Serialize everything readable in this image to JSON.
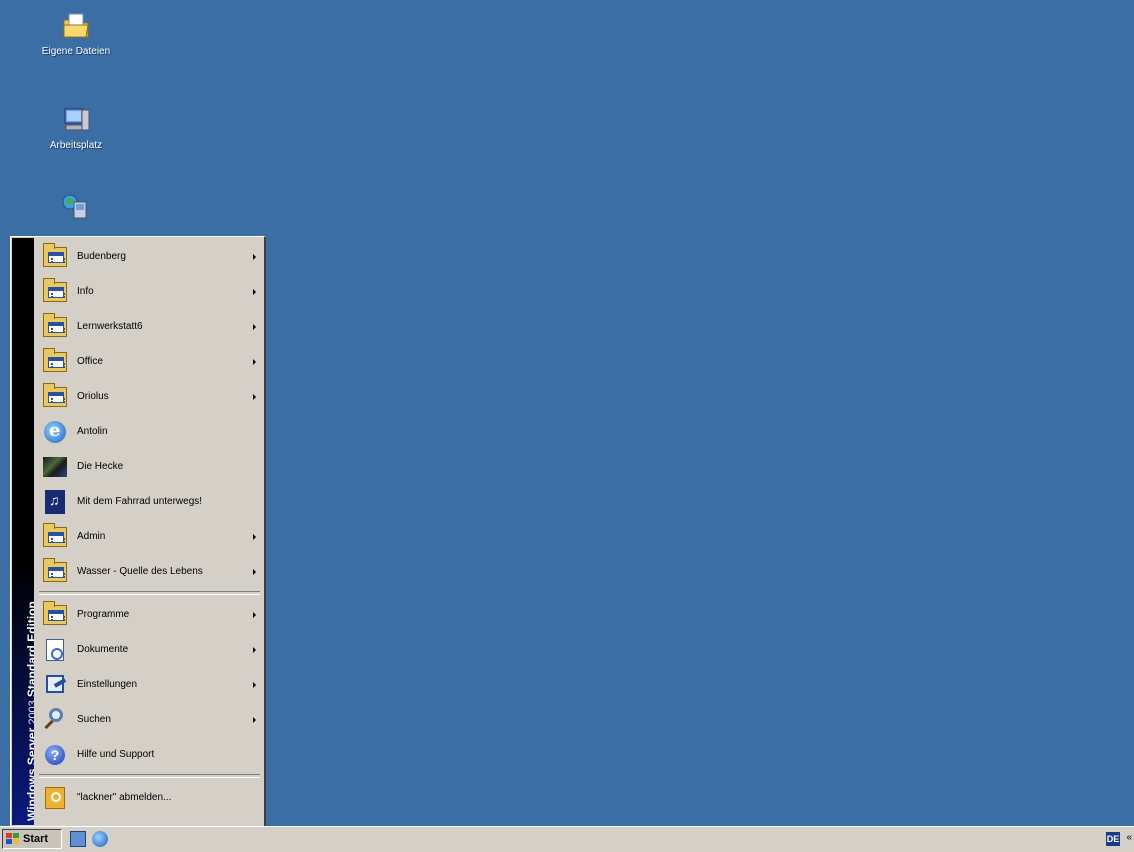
{
  "desktop": {
    "icons": [
      {
        "label": "Eigene Dateien",
        "icon": "my-documents-icon"
      },
      {
        "label": "Arbeitsplatz",
        "icon": "my-computer-icon"
      },
      {
        "label": "",
        "icon": "network-places-icon"
      }
    ],
    "background_color": "#3a6ea5"
  },
  "start_menu": {
    "banner": {
      "brand": "Windows Server",
      "version": " 2003 ",
      "edition": "Standard Edition"
    },
    "pinned_items": [
      {
        "label": "Budenberg",
        "icon": "program-folder-icon",
        "submenu": true
      },
      {
        "label": "Info",
        "icon": "program-folder-icon",
        "submenu": true
      },
      {
        "label": "Lernwerkstatt6",
        "icon": "program-folder-icon",
        "submenu": true
      },
      {
        "label": "Office",
        "icon": "program-folder-icon",
        "submenu": true
      },
      {
        "label": "Oriolus",
        "icon": "program-folder-icon",
        "submenu": true
      },
      {
        "label": "Antolin",
        "icon": "internet-explorer-icon",
        "submenu": false
      },
      {
        "label": "Die Hecke",
        "icon": "hedge-app-icon",
        "submenu": false
      },
      {
        "label": "Mit dem Fahrrad unterwegs!",
        "icon": "bicycle-app-icon",
        "submenu": false
      },
      {
        "label": "Admin",
        "icon": "program-folder-icon",
        "submenu": true
      },
      {
        "label": "Wasser - Quelle des Lebens",
        "icon": "program-folder-icon",
        "submenu": true
      }
    ],
    "system_items": [
      {
        "label": "Programme",
        "icon": "programs-icon",
        "submenu": true
      },
      {
        "label": "Dokumente",
        "icon": "documents-icon",
        "submenu": true
      },
      {
        "label": "Einstellungen",
        "icon": "settings-icon",
        "submenu": true
      },
      {
        "label": "Suchen",
        "icon": "search-icon",
        "submenu": true
      },
      {
        "label": "Hilfe und Support",
        "icon": "help-icon",
        "submenu": false
      }
    ],
    "logoff_label": "\"lackner\" abmelden..."
  },
  "taskbar": {
    "start_label": "Start",
    "quick_launch": [
      "show-desktop-icon",
      "internet-explorer-icon"
    ],
    "tray": {
      "icon_text": "DE",
      "chevron": "«"
    }
  }
}
